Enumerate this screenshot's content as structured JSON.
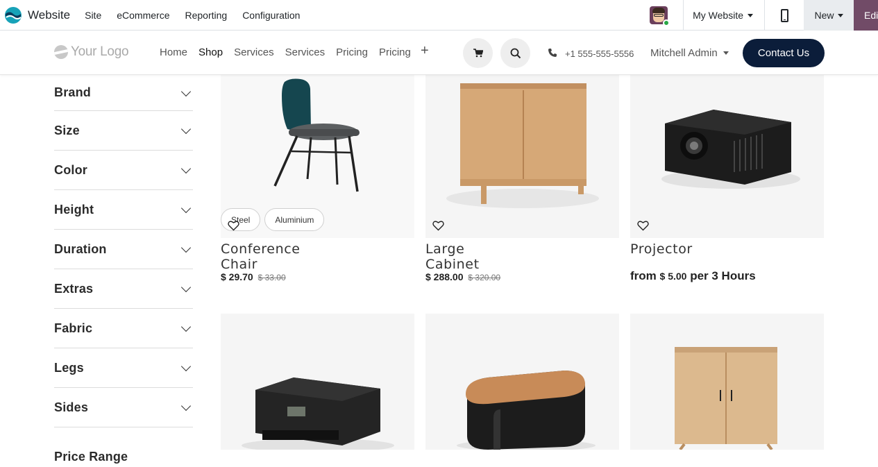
{
  "topbar": {
    "app_name": "Website",
    "menu": [
      "Site",
      "eCommerce",
      "Reporting",
      "Configuration"
    ],
    "website_selector": "My Website",
    "new_label": "New",
    "edit_label": "Edi"
  },
  "header": {
    "logo_text": "Your Logo",
    "nav": [
      "Home",
      "Shop",
      "Services",
      "Services",
      "Pricing",
      "Pricing"
    ],
    "active_nav": "Shop",
    "phone": "+1 555-555-5556",
    "user": "Mitchell Admin",
    "contact_label": "Contact Us"
  },
  "filters": [
    "Brand",
    "Size",
    "Color",
    "Height",
    "Duration",
    "Extras",
    "Fabric",
    "Legs",
    "Sides",
    "Price Range"
  ],
  "products": [
    {
      "name": "Conference Chair",
      "price": "$ 29.70",
      "old_price": "$ 33.00",
      "variants": [
        "Steel",
        "Aluminium"
      ]
    },
    {
      "name": "Large Cabinet",
      "price": "$ 288.00",
      "old_price": "$ 320.00"
    },
    {
      "name": "Projector",
      "price_prefix": "from",
      "price": "$ 5.00",
      "price_suffix": "per 3 Hours"
    }
  ],
  "colors": {
    "brand_purple": "#714b67",
    "contact_bg": "#0b1d3a",
    "online_green": "#28a745"
  },
  "icons": [
    "app-logo-icon",
    "mobile-preview-icon",
    "cart-icon",
    "search-icon",
    "phone-icon",
    "heart-icon",
    "chevron-down-icon",
    "plus-icon"
  ]
}
